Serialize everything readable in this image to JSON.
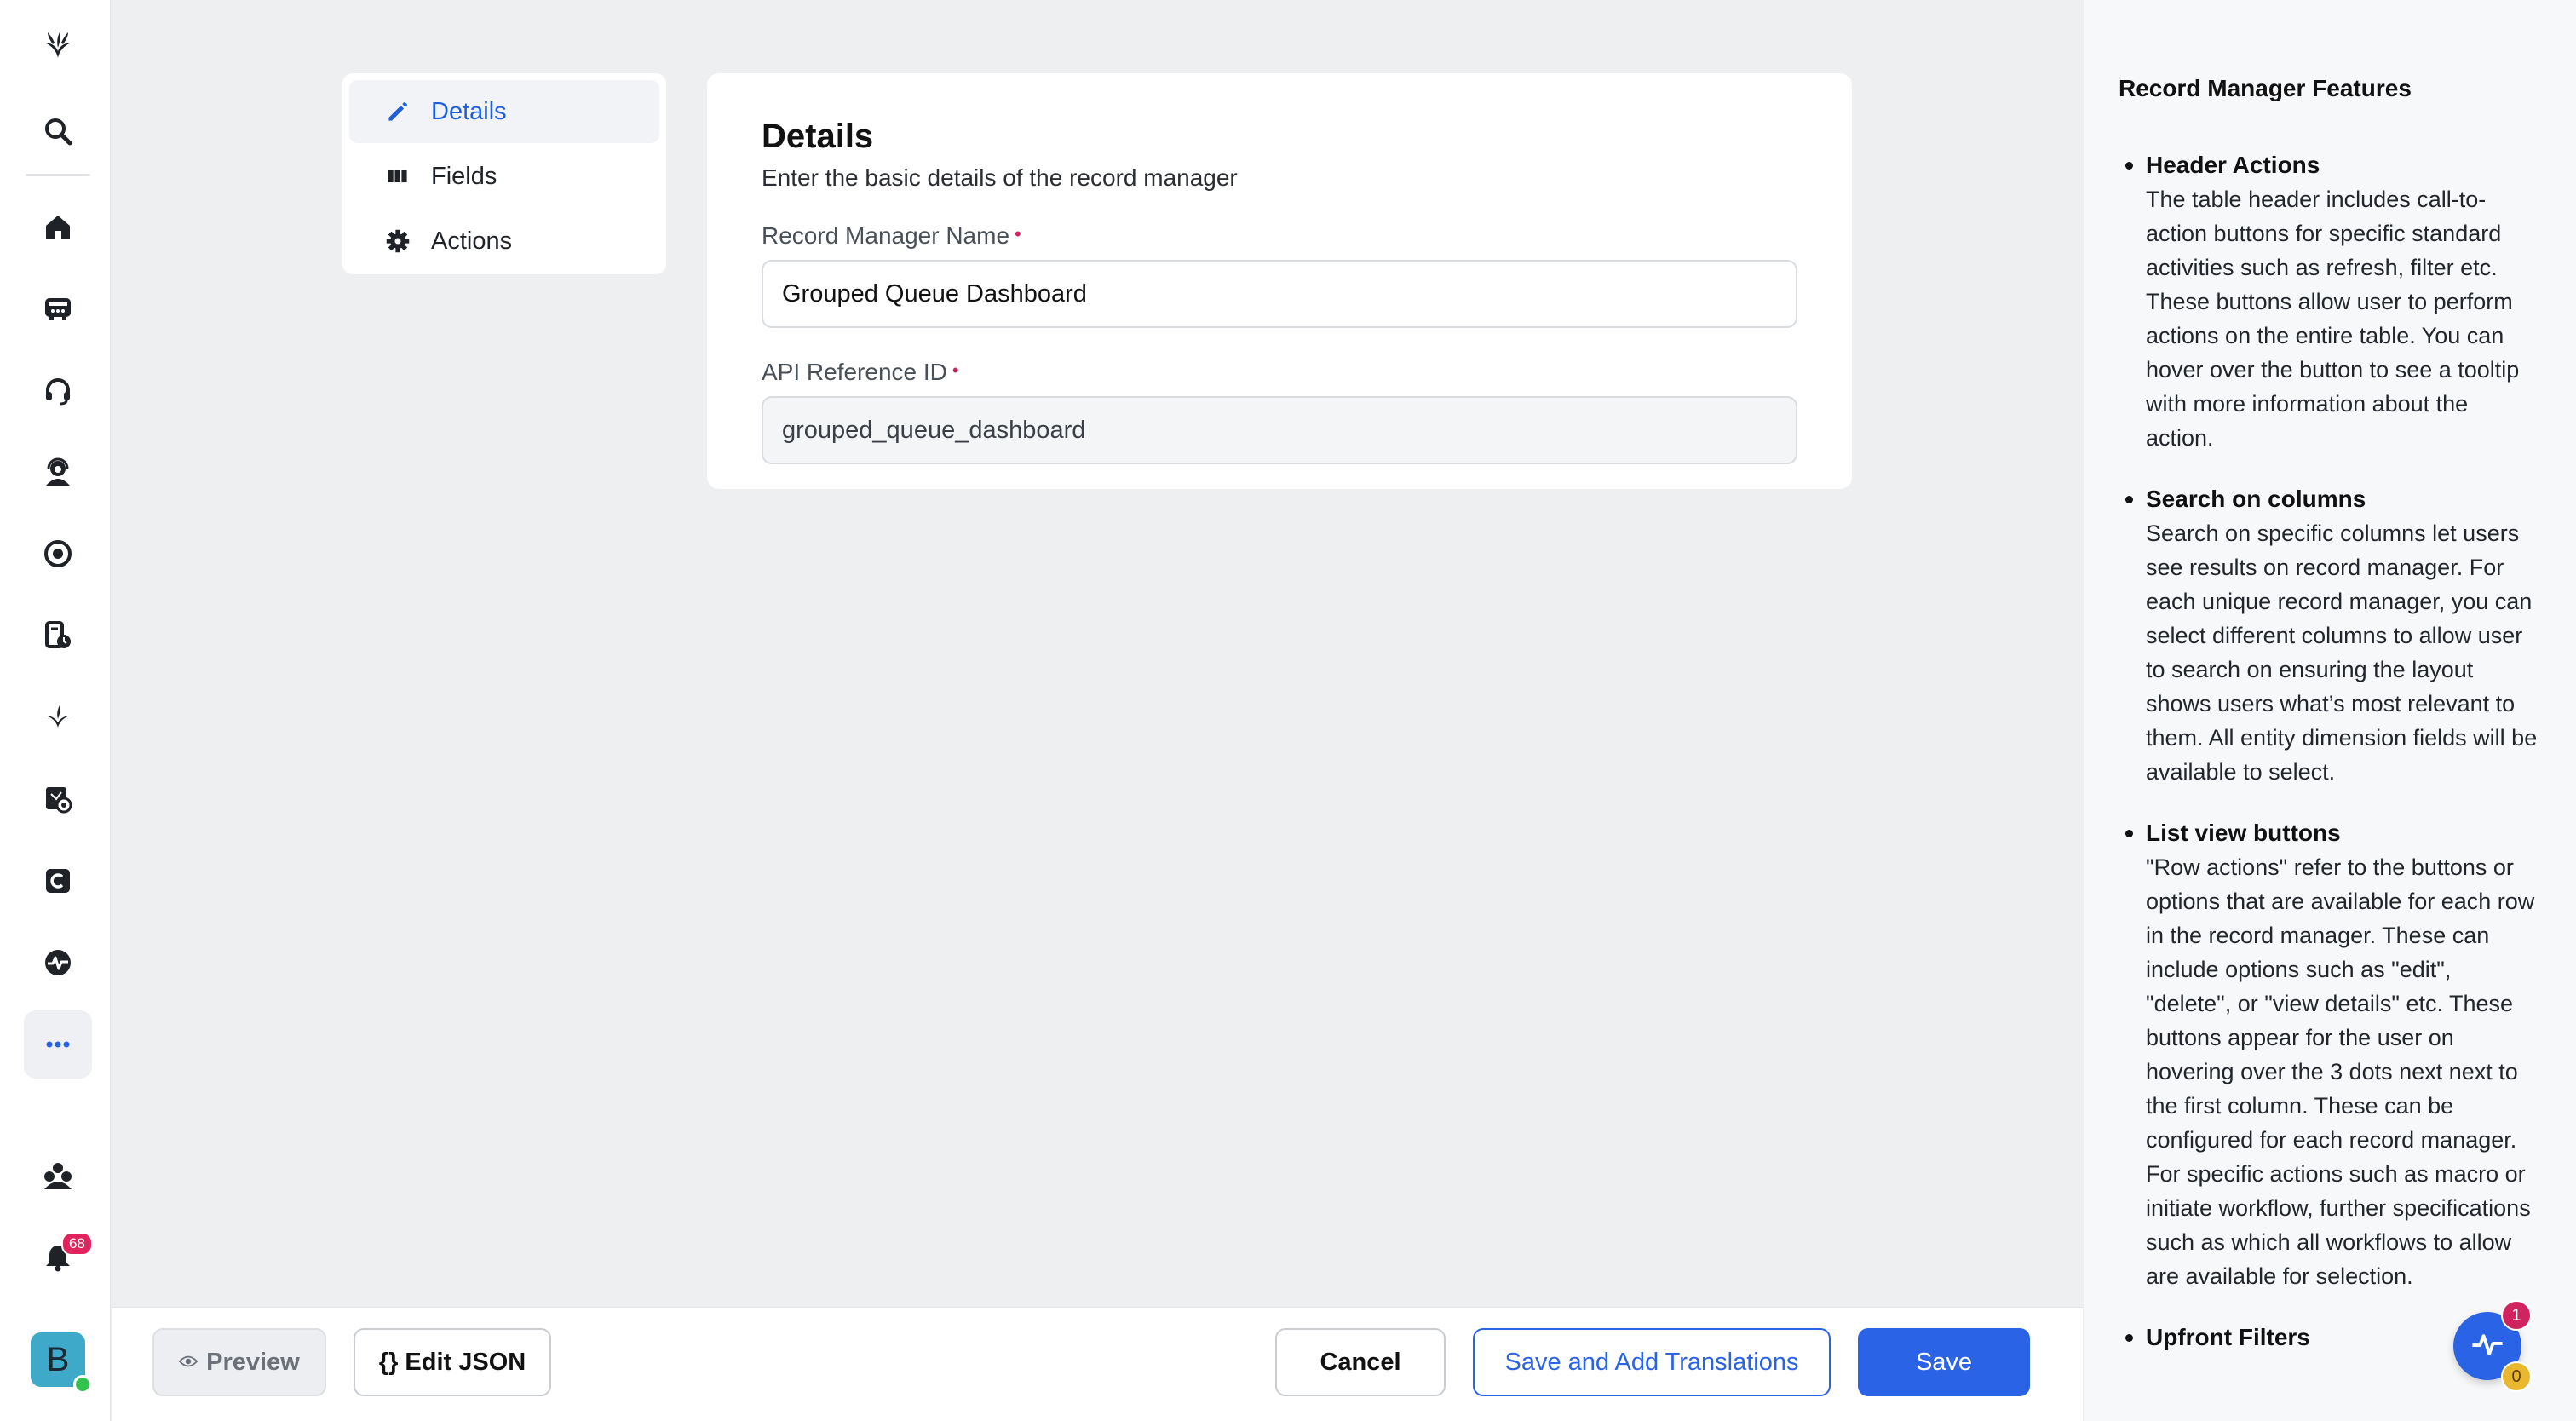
{
  "rail": {
    "notification_count": "68",
    "avatar_initial": "B",
    "icons": [
      "logo-icon",
      "search-icon",
      "home-icon",
      "inbox-icon",
      "headset-icon",
      "agent-icon",
      "record-icon",
      "report-icon",
      "sprout-icon",
      "monitor-icon",
      "c-app-icon",
      "pulse-icon",
      "more-icon",
      "community-icon",
      "bell-icon"
    ]
  },
  "section_nav": {
    "items": [
      {
        "label": "Details",
        "icon": "pencil-icon"
      },
      {
        "label": "Fields",
        "icon": "columns-icon"
      },
      {
        "label": "Actions",
        "icon": "gear-icon"
      }
    ]
  },
  "details": {
    "title": "Details",
    "subtitle": "Enter the basic details of the record manager",
    "name_label": "Record Manager Name",
    "name_value": "Grouped Queue Dashboard",
    "api_label": "API Reference ID",
    "api_value": "grouped_queue_dashboard",
    "required_mark": "•"
  },
  "footer": {
    "preview": "Preview",
    "edit_json": "{} Edit JSON",
    "cancel": "Cancel",
    "save_translations": "Save and Add Translations",
    "save": "Save"
  },
  "help": {
    "title": "Record Manager Features",
    "items": [
      {
        "title": "Header Actions",
        "body": "The table header includes call-to-action buttons for specific standard activities such as refresh, filter etc. These buttons allow user to perform actions on the entire table. You can hover over the button to see a tooltip with more information about the action."
      },
      {
        "title": "Search on columns",
        "body": "Search on specific columns let users see results on record manager. For each unique record manager, you can select different columns to allow user to search on ensuring the layout shows users what’s most relevant to them. All entity dimension fields will be available to select."
      },
      {
        "title": "List view buttons",
        "body": "\"Row actions\" refer to the buttons or options that are available for each row in the record manager. These can include options such as \"edit\", \"delete\", or \"view details\" etc. These buttons appear for the user on hovering over the 3 dots next next to the first column. These can be configured for each record manager. For specific actions such as macro or initiate workflow, further specifications such as which all workflows to allow are available for selection."
      },
      {
        "title": "Upfront Filters",
        "body": ""
      }
    ]
  },
  "fab": {
    "badge_top": "1",
    "badge_bottom": "0"
  },
  "colors": {
    "accent": "#2b63e6",
    "required": "#d0245e",
    "background": "#eeeff1"
  }
}
